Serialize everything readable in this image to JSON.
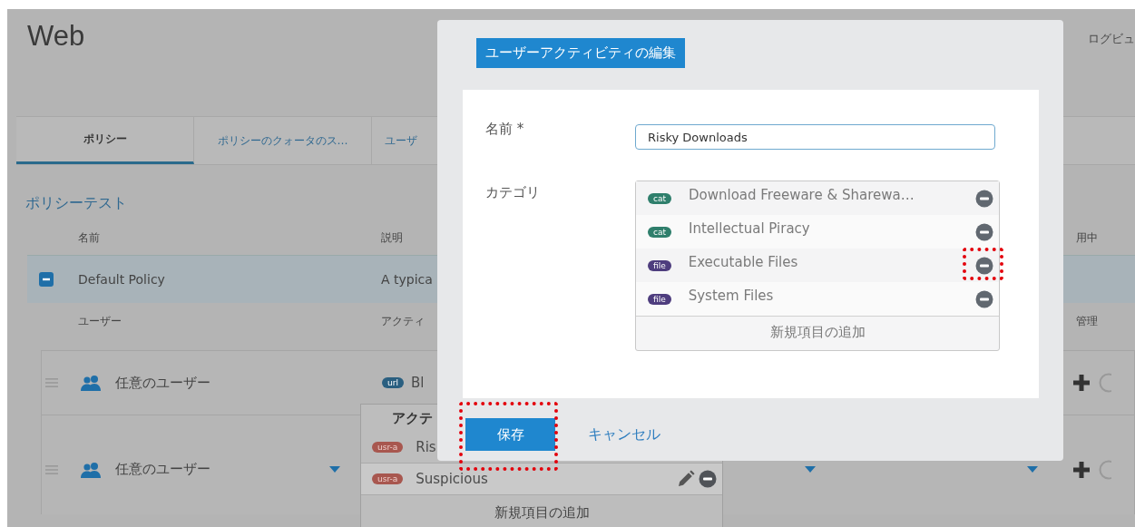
{
  "page": {
    "title": "Web",
    "top_link": "ログビュ"
  },
  "tabs": [
    {
      "label": "ポリシー",
      "selected": true
    },
    {
      "label": "ポリシーのクォータのス…",
      "selected": false
    },
    {
      "label": "ユーザ",
      "selected": false
    }
  ],
  "section_link": "ポリシーテスト",
  "table": {
    "columns": [
      "名前",
      "説明",
      "用中"
    ],
    "policy": {
      "name": "Default Policy",
      "description": "A typica",
      "expanded": true
    },
    "sub_columns": [
      "ユーザー",
      "アクティ",
      "管理"
    ],
    "rows": [
      {
        "user": "任意のユーザー",
        "activity": {
          "kind": "url",
          "badge": "url",
          "name": "Bl"
        },
        "dropdown": false
      },
      {
        "user": "任意のユーザー",
        "dropdown": true
      }
    ]
  },
  "activity_popover": {
    "header": "アクテ",
    "items": [
      {
        "kind": "user",
        "badge": "usr-a",
        "name": "Ris",
        "hovered": false
      },
      {
        "kind": "user",
        "badge": "usr-a",
        "name": "Suspicious",
        "hovered": true
      }
    ],
    "add_label": "新規項目の追加"
  },
  "dialog": {
    "title": "ユーザーアクティビティの編集",
    "name_label": "名前 *",
    "name_value": "Risky Downloads",
    "category_label": "カテゴリ",
    "categories": [
      {
        "kind": "category",
        "badge": "cat",
        "name": "Download Freeware & Sharewa…",
        "annotated": false
      },
      {
        "kind": "category",
        "badge": "cat",
        "name": "Intellectual Piracy",
        "annotated": false
      },
      {
        "kind": "file",
        "badge": "file",
        "name": "Executable Files",
        "annotated": true
      },
      {
        "kind": "file",
        "badge": "file",
        "name": "System Files",
        "annotated": false
      }
    ],
    "add_label": "新規項目の追加",
    "save": {
      "label": "保存",
      "annotated": true
    },
    "cancel": "キャンセル"
  }
}
